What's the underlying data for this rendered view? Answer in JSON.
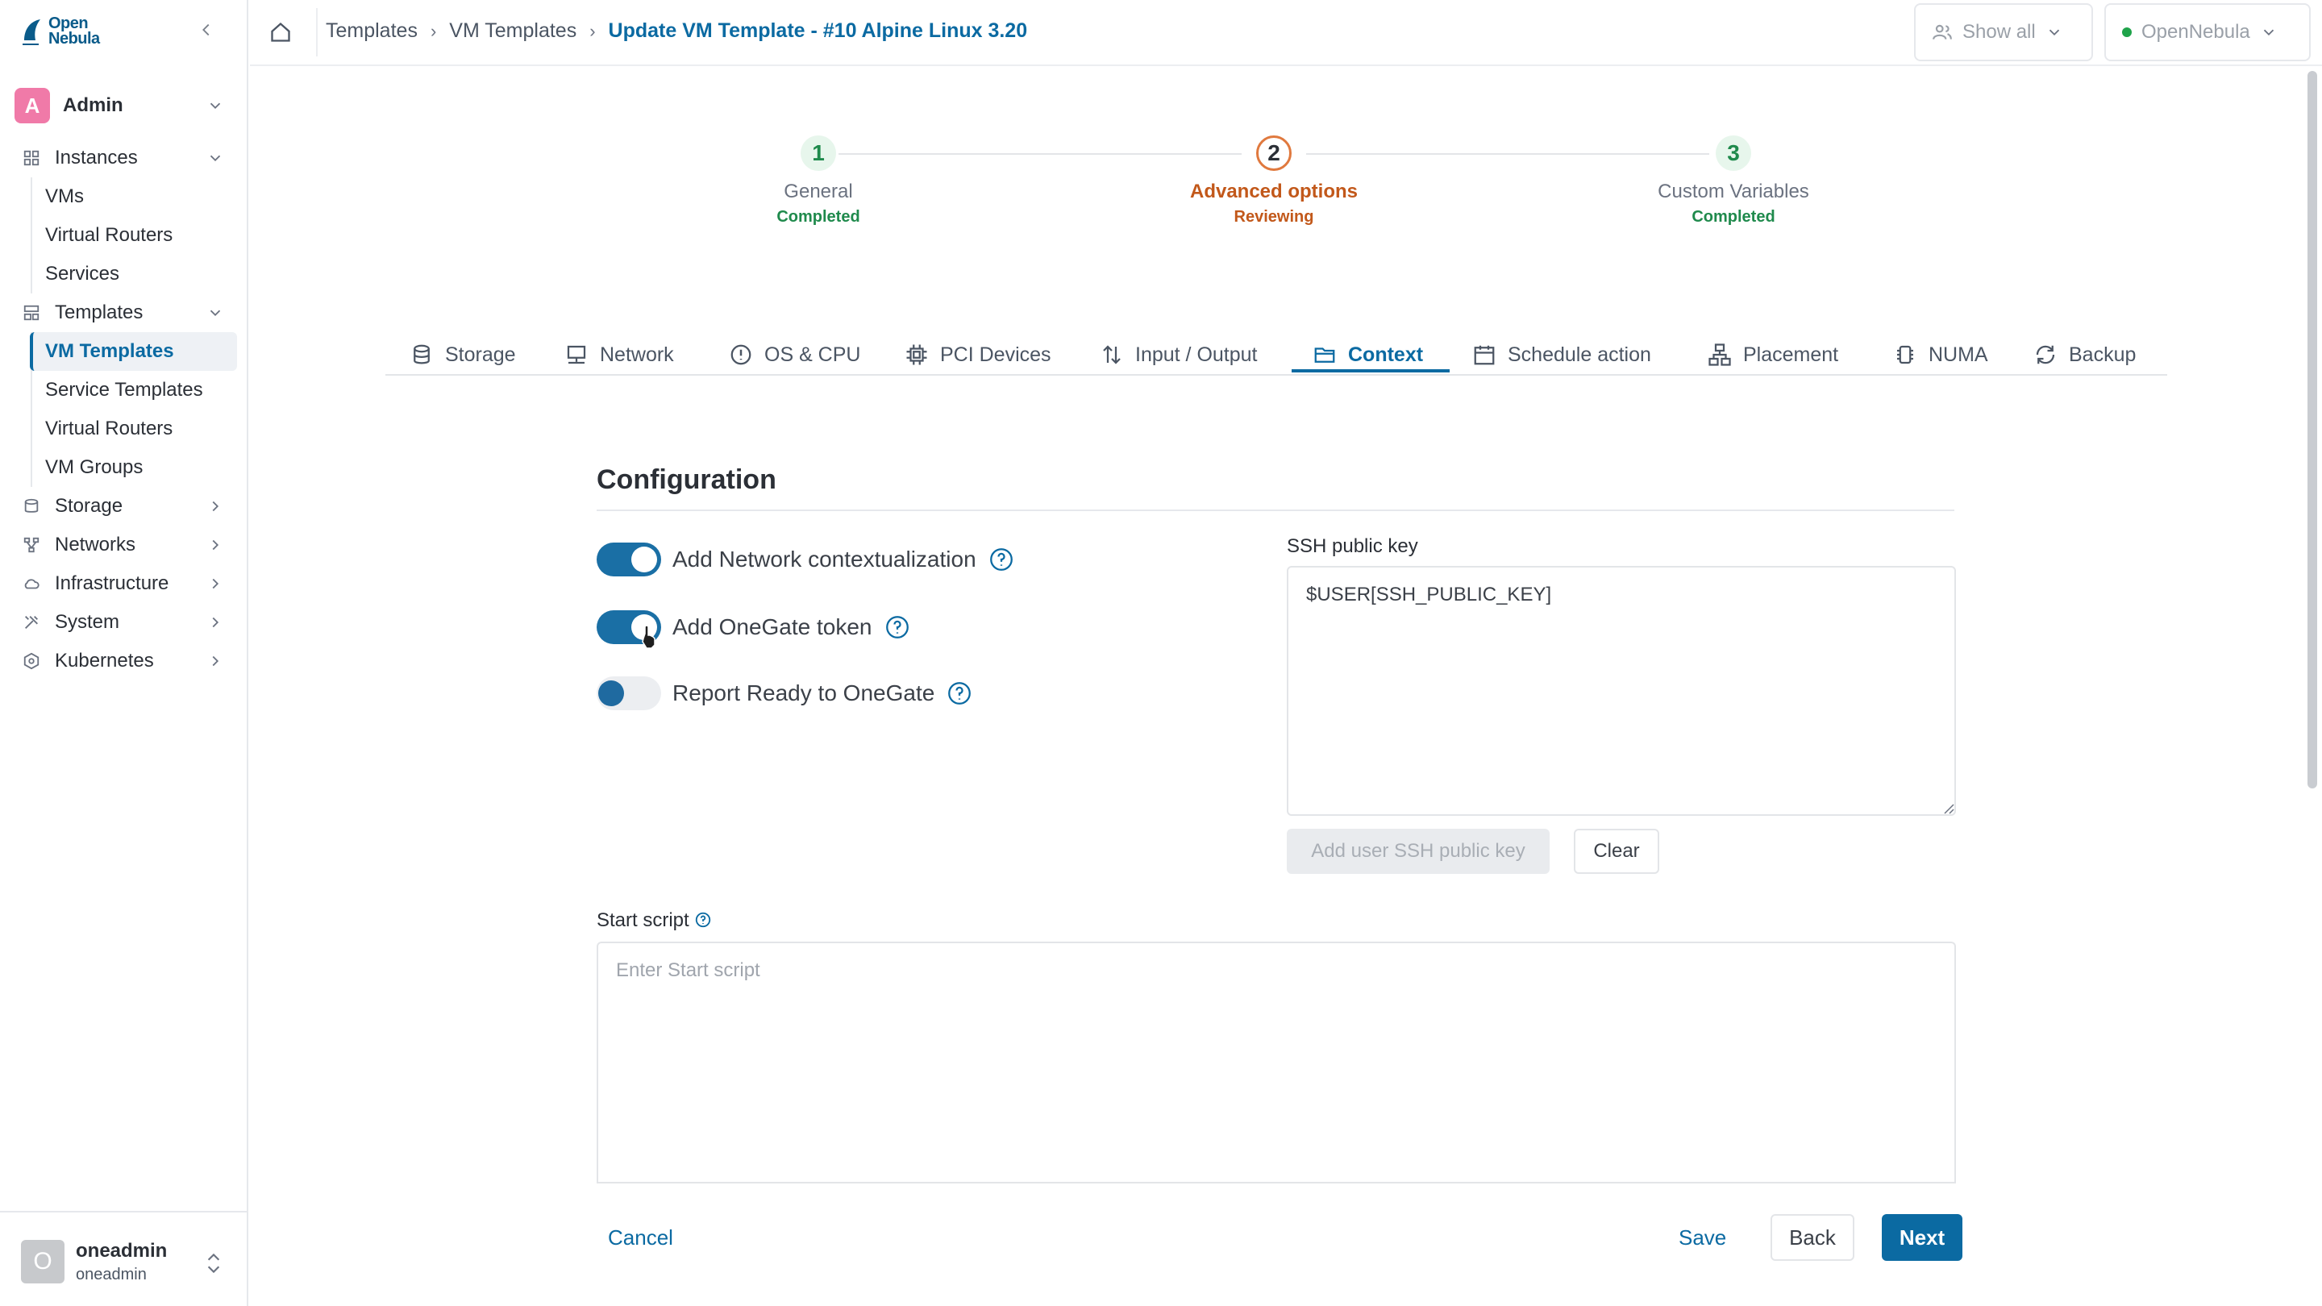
{
  "app": {
    "logo_line1": "Open",
    "logo_line2": "Nebula"
  },
  "sidebar": {
    "user": {
      "initial": "A",
      "name": "Admin"
    },
    "sections": [
      {
        "label": "Instances",
        "icon": "grid-icon",
        "expanded": true,
        "items": [
          {
            "label": "VMs"
          },
          {
            "label": "Virtual Routers"
          },
          {
            "label": "Services"
          }
        ]
      },
      {
        "label": "Templates",
        "icon": "template-icon",
        "expanded": true,
        "items": [
          {
            "label": "VM Templates",
            "active": true
          },
          {
            "label": "Service Templates"
          },
          {
            "label": "Virtual Routers"
          },
          {
            "label": "VM Groups"
          }
        ]
      },
      {
        "label": "Storage",
        "icon": "database-icon",
        "expanded": false
      },
      {
        "label": "Networks",
        "icon": "network-icon",
        "expanded": false
      },
      {
        "label": "Infrastructure",
        "icon": "cloud-icon",
        "expanded": false
      },
      {
        "label": "System",
        "icon": "tools-icon",
        "expanded": false
      },
      {
        "label": "Kubernetes",
        "icon": "kubernetes-icon",
        "expanded": false
      }
    ],
    "bottom_user": {
      "initial": "O",
      "name": "oneadmin",
      "group": "oneadmin"
    }
  },
  "topbar": {
    "breadcrumbs": [
      "Templates",
      "VM Templates"
    ],
    "current": "Update VM Template - #10 Alpine Linux 3.20",
    "show_all": "Show all",
    "zone": "OpenNebula",
    "zone_status_color": "#1fa34a"
  },
  "stepper": [
    {
      "num": "1",
      "title": "General",
      "status": "Completed",
      "state": "done"
    },
    {
      "num": "2",
      "title": "Advanced options",
      "status": "Reviewing",
      "state": "current"
    },
    {
      "num": "3",
      "title": "Custom Variables",
      "status": "Completed",
      "state": "done"
    }
  ],
  "tabs": [
    {
      "label": "Storage",
      "icon": "database-icon"
    },
    {
      "label": "Network",
      "icon": "monitor-network-icon"
    },
    {
      "label": "OS & CPU",
      "icon": "info-circle-icon"
    },
    {
      "label": "PCI Devices",
      "icon": "chip-icon"
    },
    {
      "label": "Input / Output",
      "icon": "arrows-updown-icon"
    },
    {
      "label": "Context",
      "icon": "folder-icon",
      "active": true
    },
    {
      "label": "Schedule action",
      "icon": "calendar-icon"
    },
    {
      "label": "Placement",
      "icon": "hierarchy-icon"
    },
    {
      "label": "NUMA",
      "icon": "cpu-icon"
    },
    {
      "label": "Backup",
      "icon": "refresh-icon"
    }
  ],
  "form": {
    "section_title": "Configuration",
    "toggles": [
      {
        "label": "Add Network contextualization",
        "on": true
      },
      {
        "label": "Add OneGate token",
        "on": true
      },
      {
        "label": "Report Ready to OneGate",
        "on": false
      }
    ],
    "ssh": {
      "label": "SSH public key",
      "value": "$USER[SSH_PUBLIC_KEY]",
      "add_button": "Add user SSH public key",
      "clear_button": "Clear"
    },
    "start_script": {
      "label": "Start script",
      "placeholder": "Enter Start script"
    }
  },
  "footer": {
    "cancel": "Cancel",
    "save": "Save",
    "back": "Back",
    "next": "Next"
  },
  "colors": {
    "accent": "#0b6aa2",
    "step_current": "#c2581a",
    "step_done": "#1f8a4c"
  }
}
